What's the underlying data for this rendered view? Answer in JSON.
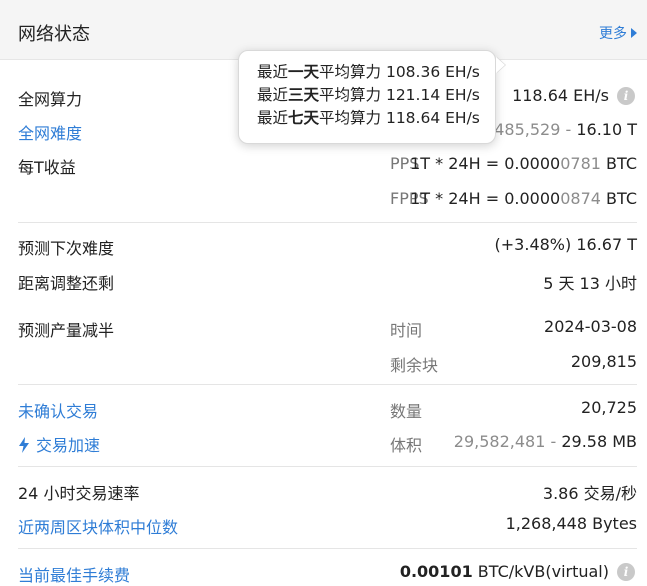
{
  "header": {
    "title": "网络状态",
    "more_label": "更多"
  },
  "tooltip": {
    "lines": [
      {
        "prefix": "最近",
        "emph": "一天",
        "suffix": "平均算力 108.36 EH/s"
      },
      {
        "prefix": "最近",
        "emph": "三天",
        "suffix": "平均算力 121.14 EH/s"
      },
      {
        "prefix": "最近",
        "emph": "七天",
        "suffix": "平均算力 118.64 EH/s"
      }
    ]
  },
  "hashrate": {
    "label": "全网算力",
    "value": "118.64 EH/s"
  },
  "difficulty": {
    "label": "全网难度",
    "value_grey": "07,485,529",
    "value_sep": " - ",
    "value_main": "16.10 T"
  },
  "per_t_income": {
    "label": "每T收益",
    "pps": {
      "label": "PPS",
      "formula": "1T * 24H = 0.0000",
      "grey": "0781",
      "unit": " BTC"
    },
    "fpps": {
      "label": "FPPS",
      "formula": "1T * 24H = 0.0000",
      "grey": "0874",
      "unit": " BTC"
    }
  },
  "next_difficulty": {
    "label": "预测下次难度",
    "value": "(+3.48%) 16.67 T"
  },
  "adjust_remaining": {
    "label": "距离调整还剩",
    "value": "5 天 13 小时"
  },
  "halving": {
    "label": "预测产量减半",
    "time_label": "时间",
    "time_value": "2024-03-08",
    "blocks_label": "剩余块",
    "blocks_value": "209,815"
  },
  "unconfirmed": {
    "label": "未确认交易",
    "count_label": "数量",
    "count_value": "20,725"
  },
  "accelerate": {
    "label": "交易加速",
    "size_label": "体积",
    "size_grey": "29,582,481",
    "size_sep": " - ",
    "size_main": "29.58 MB"
  },
  "tx_rate": {
    "label": "24 小时交易速率",
    "value": "3.86 交易/秒"
  },
  "median_block": {
    "label": "近两周区块体积中位数",
    "value": "1,268,448 Bytes"
  },
  "best_fee": {
    "label": "当前最佳手续费",
    "value_bold": "0.00101",
    "value_rest": " BTC/kVB(virtual)"
  },
  "colors": {
    "link": "#2f7dd6",
    "grey": "#8c8c8c",
    "header_bg": "#f5f5f5"
  }
}
